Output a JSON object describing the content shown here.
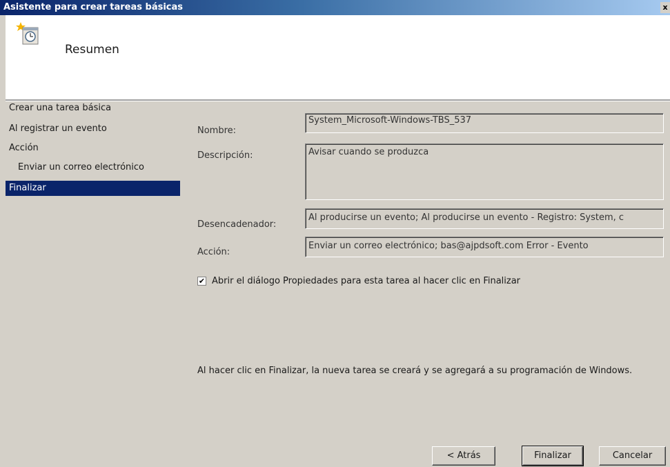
{
  "window": {
    "title": "Asistente para crear tareas básicas",
    "close_glyph": "x"
  },
  "header": {
    "title": "Resumen",
    "icon": "task-scheduler-icon"
  },
  "nav": {
    "items": [
      {
        "label": "Crear una tarea básica"
      },
      {
        "label": "Al registrar un evento"
      },
      {
        "label": "Acción"
      },
      {
        "label": "Enviar un correo electrónico"
      },
      {
        "label": "Finalizar"
      }
    ]
  },
  "summary": {
    "name_label": "Nombre:",
    "name_value": "System_Microsoft-Windows-TBS_537",
    "description_label": "Descripción:",
    "description_value": "Avisar cuando se produzca",
    "trigger_label": "Desencadenador:",
    "trigger_value": "Al producirse un evento; Al producirse un evento - Registro: System, c",
    "action_label": "Acción:",
    "action_value": "Enviar un correo electrónico; bas@ajpdsoft.com Error - Evento"
  },
  "options": {
    "open_properties_label": "Abrir el diálogo Propiedades para esta tarea al hacer clic en Finalizar",
    "open_properties_checked": true
  },
  "info_text": "Al hacer clic en Finalizar, la nueva tarea se creará y se agregará a su programación de Windows.",
  "buttons": {
    "back_label": "< Atrás",
    "finish_label": "Finalizar",
    "cancel_label": "Cancelar"
  },
  "colors": {
    "titlebar": "#0a246a",
    "selection": "#0a246a",
    "dialog_bg": "#d4d0c8"
  }
}
